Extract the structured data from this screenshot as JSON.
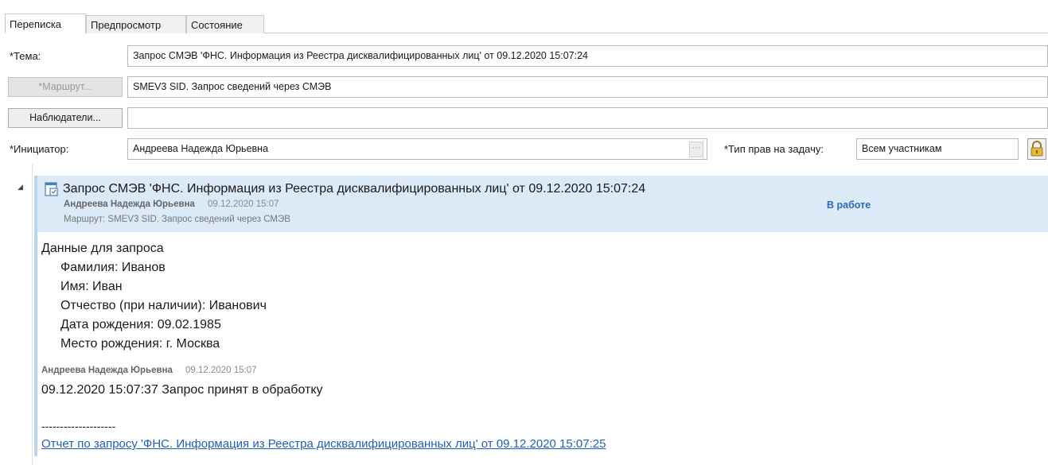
{
  "tabs": [
    {
      "label": "Переписка",
      "active": true
    },
    {
      "label": "Предпросмотр",
      "active": false
    },
    {
      "label": "Состояние",
      "active": false
    }
  ],
  "form": {
    "subject_label": "*Тема:",
    "subject_value": "Запрос СМЭВ 'ФНС. Информация из Реестра дисквалифицированных лиц' от 09.12.2020 15:07:24",
    "route_button": "*Маршрут...",
    "route_value": "SMEV3 SID. Запрос сведений через СМЭВ",
    "observers_button": "Наблюдатели...",
    "observers_value": "",
    "initiator_label": "*Инициатор:",
    "initiator_value": "Андреева Надежда Юрьевна",
    "ellipsis": "···",
    "rights_label": "*Тип прав на задачу:",
    "rights_value": "Всем участникам"
  },
  "thread": {
    "collapse_glyph": "◢",
    "title": "Запрос СМЭВ 'ФНС. Информация из Реестра дисквалифицированных лиц' от 09.12.2020 15:07:24",
    "author": "Андреева Надежда Юрьевна",
    "date": "09.12.2020 15:07",
    "route": "Маршрут: SMEV3 SID. Запрос сведений через СМЭВ",
    "status": "В работе",
    "body_heading": "Данные для запроса",
    "body_lines": [
      "Фамилия: Иванов",
      "Имя: Иван",
      "Отчество (при наличии): Иванович",
      "Дата рождения: 09.02.1985",
      "Место рождения: г. Москва"
    ],
    "reply": {
      "author": "Андреева Надежда Юрьевна",
      "date": "09.12.2020 15:07",
      "text": "09.12.2020 15:07:37 Запрос принят в обработку",
      "separator": "--------------------",
      "link": "Отчет по запросу 'ФНС. Информация из Реестра дисквалифицированных лиц' от 09.12.2020 15:07:25"
    }
  },
  "colors": {
    "header_bg": "#dce9f7",
    "accent": "#b9d6ee",
    "status": "#2a6bb5",
    "link": "#1f5fbf"
  },
  "icons": {
    "task": "task-icon",
    "lock": "lock-icon",
    "collapse": "collapse-arrow-icon"
  }
}
